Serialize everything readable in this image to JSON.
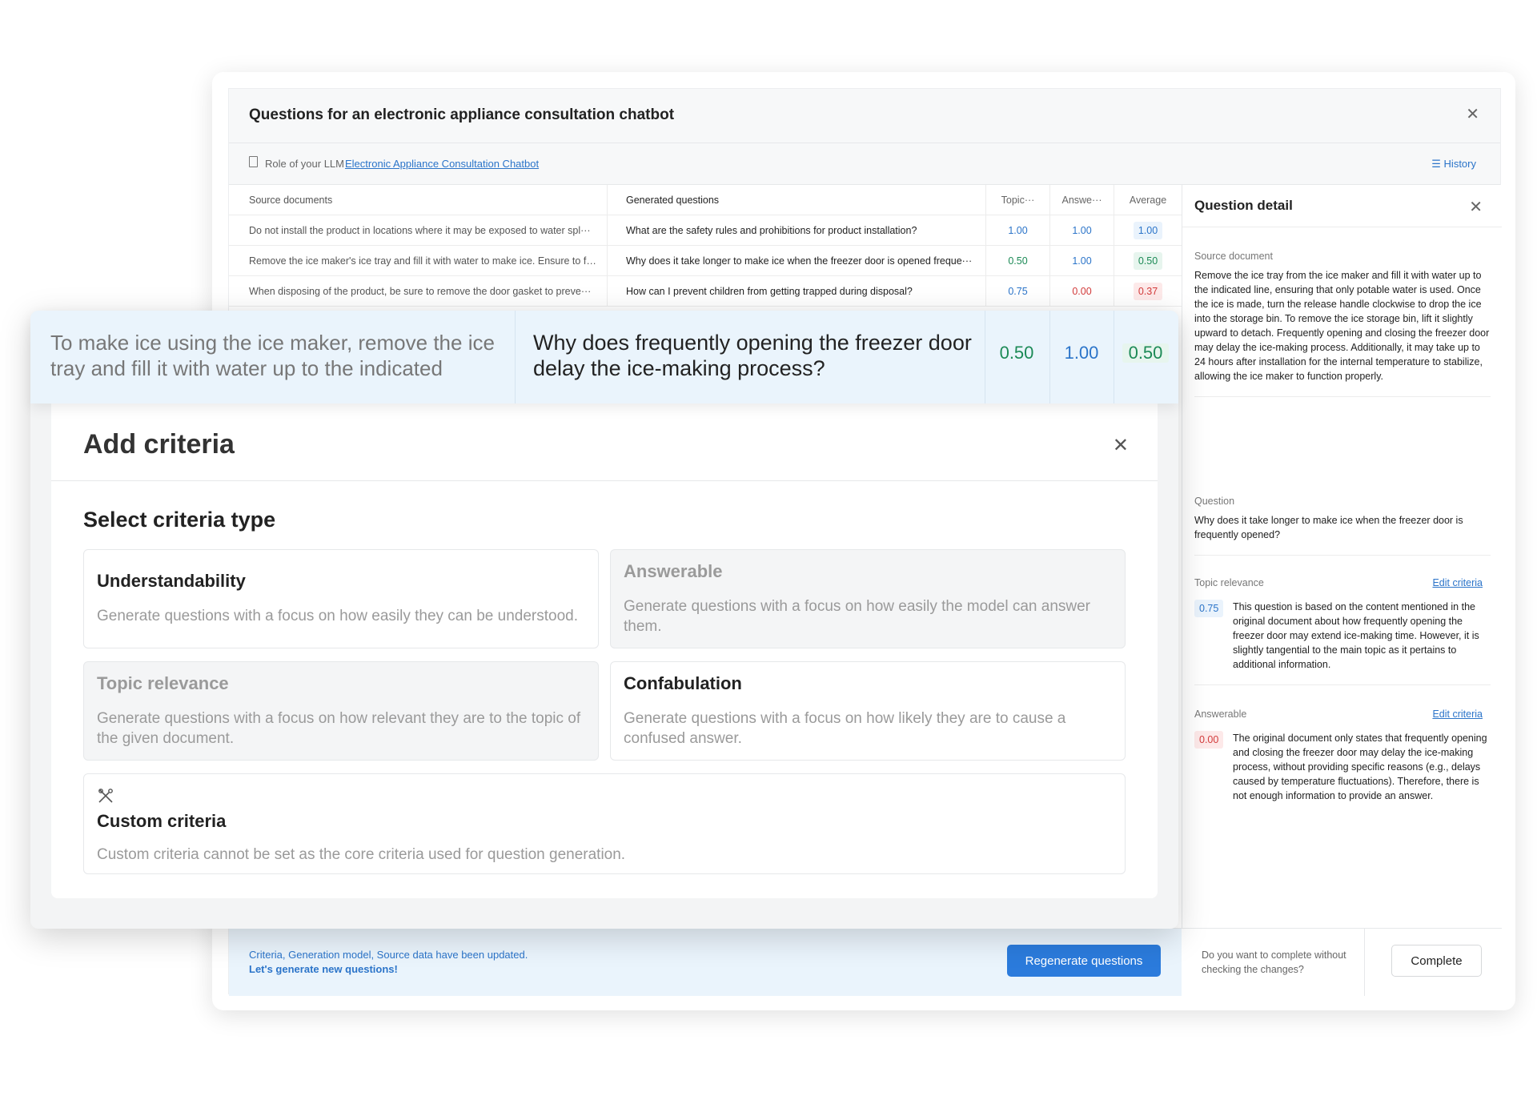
{
  "panel": {
    "title": "Questions for an electronic appliance consultation chatbot",
    "role_label": "Role of your LLM",
    "role_link": "Electronic Appliance Consultation Chatbot",
    "history_label": "History"
  },
  "table": {
    "headers": {
      "source": "Source documents",
      "question": "Generated questions",
      "topic": "Topic···",
      "answerable": "Answe···",
      "average": "Average"
    },
    "rows": [
      {
        "source": "Do not install the product in locations where it may be exposed to water spl···",
        "question": "What are the safety rules and prohibitions for product installation?",
        "topic": "1.00",
        "answerable": "1.00",
        "average": "1.00"
      },
      {
        "source": "Remove the ice maker's ice tray and fill it with water to make ice. Ensure to fi···",
        "question": "Why does it take longer to make ice when the freezer door is opened freque···",
        "topic": "0.50",
        "answerable": "1.00",
        "average": "0.50"
      },
      {
        "source": "When disposing of the product, be sure to remove the door gasket to preve···",
        "question": "How can I prevent children from getting trapped during disposal?",
        "topic": "0.75",
        "answerable": "0.00",
        "average": "0.37"
      }
    ]
  },
  "highlight_row": {
    "source": "To make ice using the ice maker, remove the ice tray and fill it with water up to the indicated line,···",
    "question": "Why does frequently opening the freezer door delay the ice-making process?",
    "topic": "0.50",
    "answerable": "1.00",
    "average": "0.50"
  },
  "detail": {
    "title": "Question detail",
    "source_label": "Source document",
    "source_text": "Remove the ice tray from the ice maker and fill it with water up to the indicated line, ensuring that only potable water is used. Once the ice is made, turn the release handle clockwise to drop the ice into the storage bin. To remove the ice storage bin, lift it slightly upward to detach. Frequently opening and closing the freezer door may delay the ice-making process. Additionally, it may take up to 24 hours after installation for the internal temperature to stabilize, allowing the ice maker to function properly.",
    "question_label": "Question",
    "question_text": "Why does it take longer to make ice when the freezer door is frequently opened?",
    "topic_label": "Topic relevance",
    "edit_label": "Edit criteria",
    "topic_score": "0.75",
    "topic_text": "This question is based on the content mentioned in the original document about how frequently opening the freezer door may extend ice-making time. However, it is slightly tangential to the main topic as it pertains to additional information.",
    "answerable_label": "Answerable",
    "answerable_score": "0.00",
    "answerable_text": "The original document only states that frequently opening and closing the freezer door may delay the ice-making process, without providing specific reasons (e.g., delays caused by temperature fluctuations). Therefore, there is not enough information to provide an answer."
  },
  "footer": {
    "msg_line1": "Criteria, Generation model, Source data have been updated.",
    "msg_line2": "Let's generate new questions!",
    "regen_label": "Regenerate questions",
    "complete_question": "Do you want to complete without checking the changes?",
    "complete_label": "Complete"
  },
  "dialog": {
    "title": "Add criteria",
    "subtitle": "Select criteria type",
    "cards": {
      "understandability": {
        "title": "Understandability",
        "desc": "Generate questions with a focus on how easily they can be understood."
      },
      "answerable": {
        "title": "Answerable",
        "desc": "Generate questions with a focus on how easily the model can answer them."
      },
      "topic_relevance": {
        "title": "Topic relevance",
        "desc": "Generate questions with a focus on how relevant they are to the topic of the given document."
      },
      "confabulation": {
        "title": "Confabulation",
        "desc": "Generate questions with a focus on how likely they are to cause a confused answer."
      },
      "custom": {
        "title": "Custom criteria",
        "desc": "Custom criteria cannot be set as the core criteria used for question generation."
      }
    }
  },
  "colors": {
    "accent_blue": "#2b7bdc",
    "score_green": "#1c8a56",
    "score_red": "#d33b3b",
    "highlight_bg": "#eaf4fc"
  },
  "icons": {
    "close": "close-icon",
    "document": "document-icon",
    "history": "list-icon",
    "custom": "magic-wand-icon"
  }
}
